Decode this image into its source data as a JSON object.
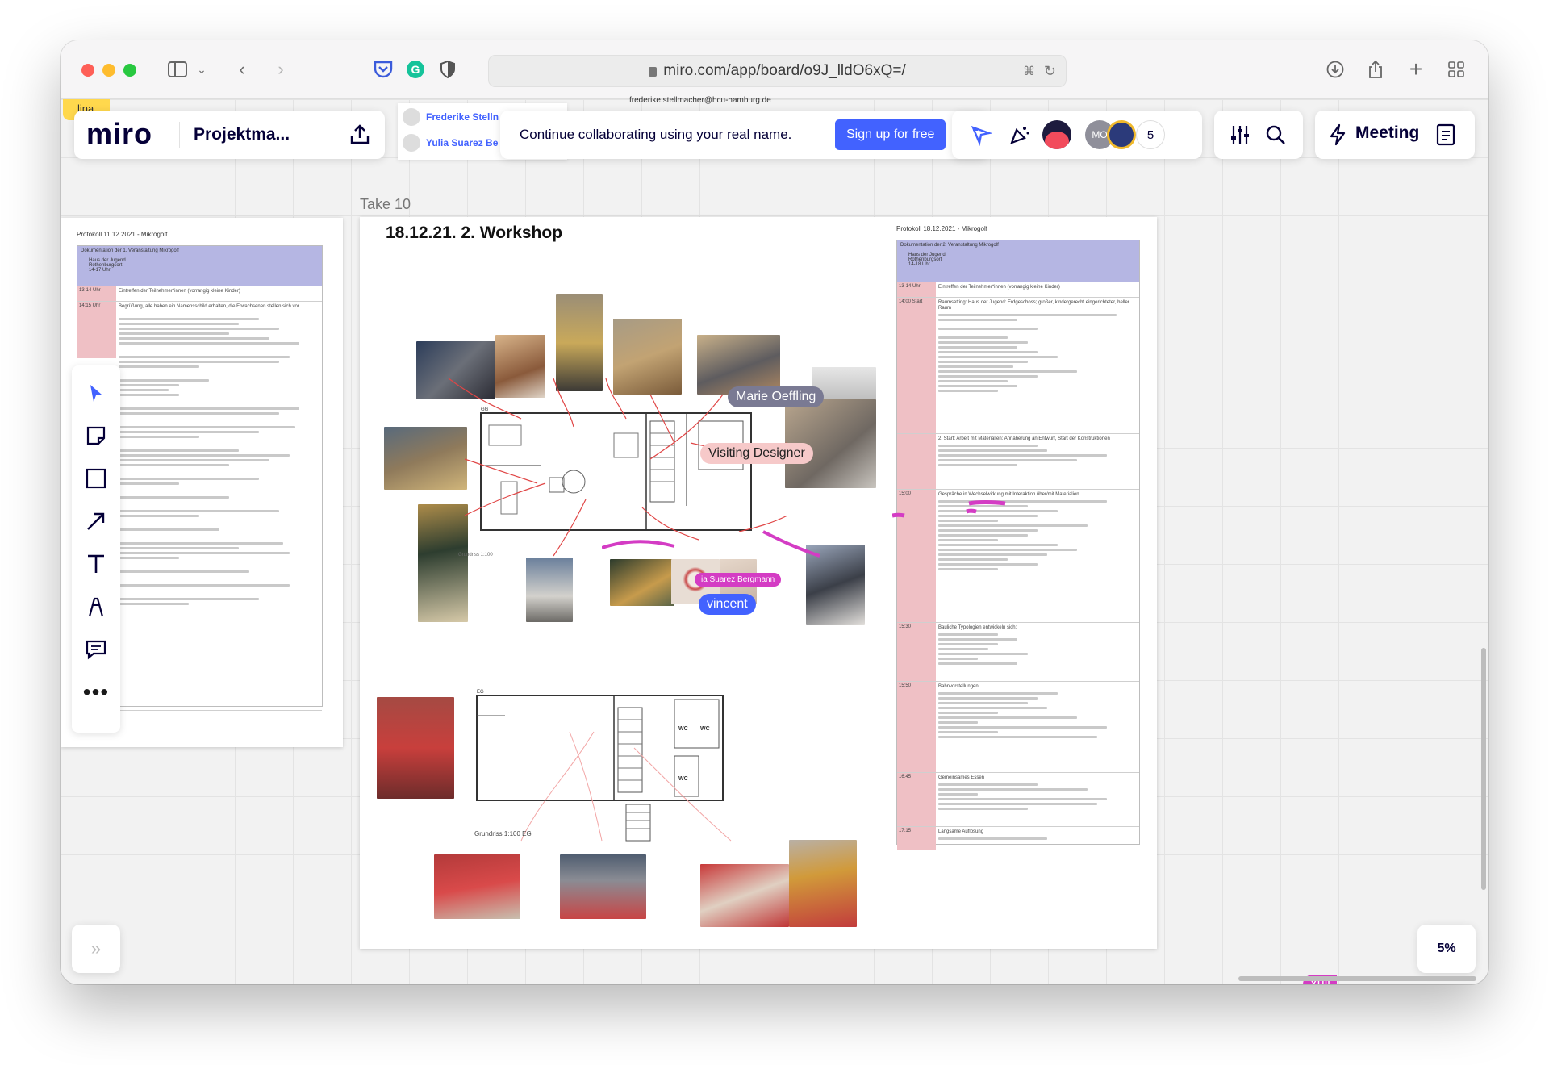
{
  "browser": {
    "url": "miro.com/app/board/o9J_lldO6xQ=/",
    "icons": [
      "sidebar-icon",
      "chevron-down-icon",
      "back-icon",
      "forward-icon",
      "pocket-icon",
      "grammarly-icon",
      "shield-icon",
      "translate-icon",
      "reload-icon",
      "download-icon",
      "share-icon",
      "new-tab-icon",
      "tab-overview-icon"
    ]
  },
  "header": {
    "logo": "miro",
    "board_name": "Projektma...",
    "collaborators": [
      "Frederike Stelln",
      "Yulia Suarez Be"
    ],
    "email": "frederike.stellmacher@hcu-hamburg.de",
    "banner_text": "Continue collaborating using your real name.",
    "signup_label": "Sign up for free",
    "avatar_initials": "MO",
    "participants_count": "5",
    "meeting_label": "Meeting"
  },
  "sticky_label": "lina",
  "frame": {
    "label": "Take 10",
    "title": "18.12.21. 2. Workshop",
    "plan1_label": "Grundriss 1:100",
    "plan2_label": "Grundriss 1:100 EG",
    "plan_eg": "EG",
    "wc": [
      "WC",
      "WC",
      "WC"
    ]
  },
  "left_doc": {
    "title": "Protokoll 11.12.2021 - Mikrogolf",
    "head": "Dokumentation der 1. Veranstaltung Mikrogolf",
    "head_items": [
      "Haus der Jugend",
      "Rothenburgsort",
      "14-17 Uhr"
    ],
    "rows": [
      {
        "time": "13-14 Uhr",
        "text": "Eintreffen der Teilnehmer*innen (vorrangig kleine Kinder)"
      },
      {
        "time": "14:15 Uhr",
        "text": "Begrüßung, alle haben ein Namensschild erhalten, die Erwachsenen stellen sich vor"
      }
    ]
  },
  "right_doc": {
    "title": "Protokoll 18.12.2021 - Mikrogolf",
    "head": "Dokumentation der 2. Veranstaltung Mikrogolf",
    "head_items": [
      "Haus der Jugend",
      "Rothenburgsort",
      "14-18 Uhr"
    ],
    "rows": [
      {
        "time": "13-14 Uhr",
        "text": "Eintreffen der Teilnehmer*innen (vorrangig kleine Kinder)"
      },
      {
        "time": "14:00 Start",
        "text": "Raumsetting: Haus der Jugend: Erdgeschoss; großer, kindergerecht eingerichteter, heller Raum"
      },
      {
        "time": "",
        "text": "2. Start: Arbeit mit Materialien: Annäherung an Entwurf, Start der Konstruktionen"
      },
      {
        "time": "15:00",
        "text": "Gespräche in Wechselwirkung mit Interaktion über/mit Materialien"
      },
      {
        "time": "15:30",
        "text": "Bauliche Typologien entwickeln sich:"
      },
      {
        "time": "15:50",
        "text": "Bahnvorstellungen"
      },
      {
        "time": "16:45",
        "text": "Gemeinsames Essen"
      },
      {
        "time": "17:15",
        "text": "Langsame Auflösung"
      }
    ]
  },
  "cursors": [
    {
      "name": "Marie Oeffling",
      "color": "#7a7a93"
    },
    {
      "name": "Visiting Designer",
      "color": "#f6c9c9"
    },
    {
      "name": "vincent",
      "color": "#4262ff"
    },
    {
      "name": "ia Suarez Bergmann",
      "color": "#d43cc4"
    },
    {
      "name": "Yuli",
      "color": "#d43cc4"
    }
  ],
  "tools": [
    "cursor-icon",
    "sticky-note-icon",
    "shape-icon",
    "arrow-icon",
    "text-icon",
    "pen-icon",
    "comment-icon",
    "more-icon"
  ],
  "expand_label": "»",
  "zoom": "5%",
  "colors": {
    "accent": "#4262ff",
    "miro_dark": "#050038"
  }
}
